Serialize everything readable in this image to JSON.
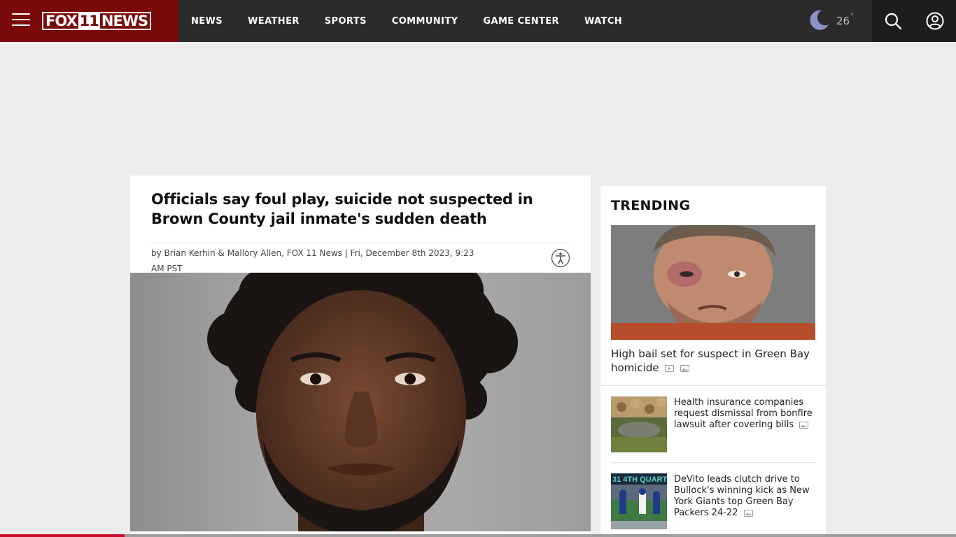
{
  "header": {
    "logo_fox": "FOX",
    "logo_eleven": "11",
    "logo_news": "NEWS",
    "nav": [
      "NEWS",
      "WEATHER",
      "SPORTS",
      "COMMUNITY",
      "GAME CENTER",
      "WATCH"
    ],
    "weather": {
      "temp": "26",
      "degree": "°",
      "icon": "moon-icon"
    }
  },
  "article": {
    "headline": "Officials say foul play, suicide not suspected in Brown County jail inmate's sudden death",
    "byline": "by Brian Kerhin & Mallory Allen, FOX 11 News | Fri, December 8th 2023, 9:23 AM PST"
  },
  "trending": {
    "title": "TRENDING",
    "lead": {
      "title": "High bail set for suspect in Green Bay homicide"
    },
    "items": [
      {
        "title": "Health insurance companies request dismissal from bonfire lawsuit after covering bills"
      },
      {
        "title": "DeVito leads clutch drive to Bullock's winning kick as New York Giants top Green Bay Packers 24-22",
        "scoreboard_text": "31 4TH QUARTE"
      }
    ]
  },
  "progress": {
    "fraction": 0.13
  },
  "colors": {
    "brand": "#7a0a0a",
    "header": "#2b2b2b",
    "accent": "#c8102e"
  }
}
